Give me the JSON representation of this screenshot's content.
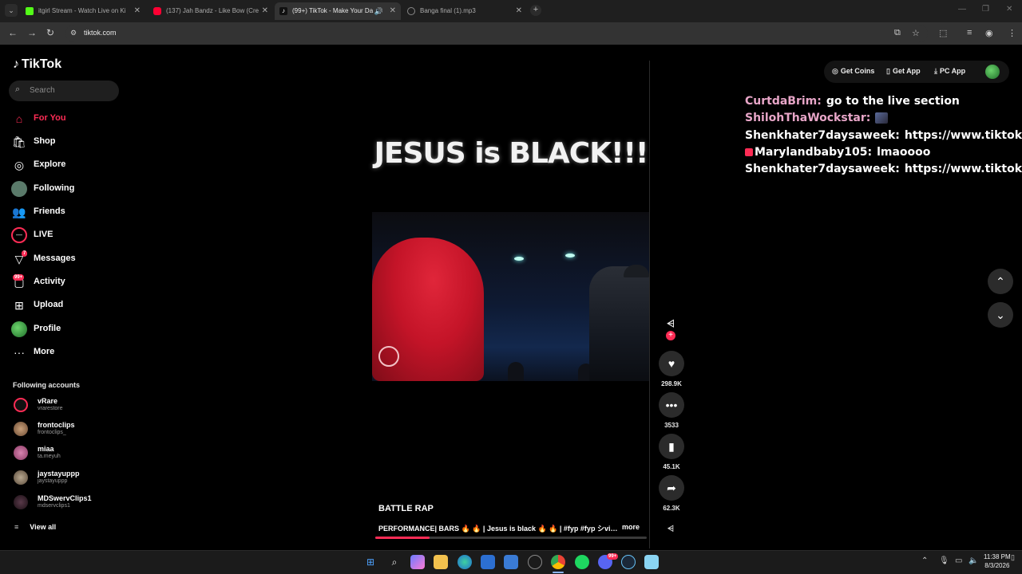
{
  "browser": {
    "tabs": [
      {
        "label": "itgirl Stream - Watch Live on Ki",
        "favicon_color": "#53fc18"
      },
      {
        "label": "(137) Jah Bandz - Like Bow (Cre",
        "favicon_color": "#ff0033"
      },
      {
        "label": "(99+) TikTok - Make Your Da",
        "favicon_color": "#000000",
        "active": true
      },
      {
        "label": "Banga final (1).mp3",
        "favicon_color": "#444444"
      }
    ],
    "url": "tiktok.com"
  },
  "sidebar": {
    "logo": "TikTok",
    "search_placeholder": "Search",
    "nav": [
      {
        "label": "For You",
        "icon": "home-icon"
      },
      {
        "label": "Shop",
        "icon": "shop-icon"
      },
      {
        "label": "Explore",
        "icon": "compass-icon"
      },
      {
        "label": "Following",
        "icon": "following-avatar-icon"
      },
      {
        "label": "Friends",
        "icon": "friends-icon"
      },
      {
        "label": "LIVE",
        "icon": "live-icon"
      },
      {
        "label": "Messages",
        "icon": "messages-icon",
        "badge": "7"
      },
      {
        "label": "Activity",
        "icon": "activity-icon",
        "badge": "99+"
      },
      {
        "label": "Upload",
        "icon": "upload-icon"
      },
      {
        "label": "Profile",
        "icon": "profile-avatar-icon"
      },
      {
        "label": "More",
        "icon": "more-icon"
      }
    ],
    "following_title": "Following accounts",
    "accounts": [
      {
        "name": "vRare",
        "handle": "vrarestore"
      },
      {
        "name": "frontoclips",
        "handle": "frontoclips_"
      },
      {
        "name": "miaa",
        "handle": "ta.meyuh"
      },
      {
        "name": "jaystayuppp",
        "handle": "jaystayuppp"
      },
      {
        "name": "MDSwervClips1",
        "handle": "mdservclips1"
      }
    ],
    "view_all": "View all"
  },
  "video": {
    "overlay_title": "JESUS is BLACK!!!",
    "username": "BATTLE RAP",
    "description": "PERFORMANCE| BARS 🔥 🔥 | Jesus is black 🔥 🔥 | #fyp #fyp シvir...",
    "more": "more",
    "progress_fraction": 0.2
  },
  "actions": {
    "likes": "298.9K",
    "comments": "3533",
    "saves": "45.1K",
    "shares": "62.3K"
  },
  "topbar": {
    "coins": "Get Coins",
    "app": "Get App",
    "pc_app": "PC App"
  },
  "chat": [
    {
      "user": "CurtdaBrim:",
      "text": "go to the live section",
      "color": "#e8a6c8"
    },
    {
      "user": "ShilohThaWockstar:",
      "text": "",
      "color": "#e8a6c8"
    },
    {
      "user": "Shenkhater7daysaweek:",
      "text": "https://www.tiktok.com/",
      "color": "#ffffff"
    },
    {
      "user": "Marylandbaby105:",
      "text": "lmaoooo",
      "color": "#ffffff"
    },
    {
      "user": "Shenkhater7daysaweek:",
      "text": "https://www.tiktok.com/",
      "color": "#ffffff"
    }
  ],
  "taskbar": {
    "time": "11:38 PM",
    "date": "8/3/2026",
    "discord_badge": "99+"
  },
  "colors": {
    "accent": "#fe2c55"
  }
}
